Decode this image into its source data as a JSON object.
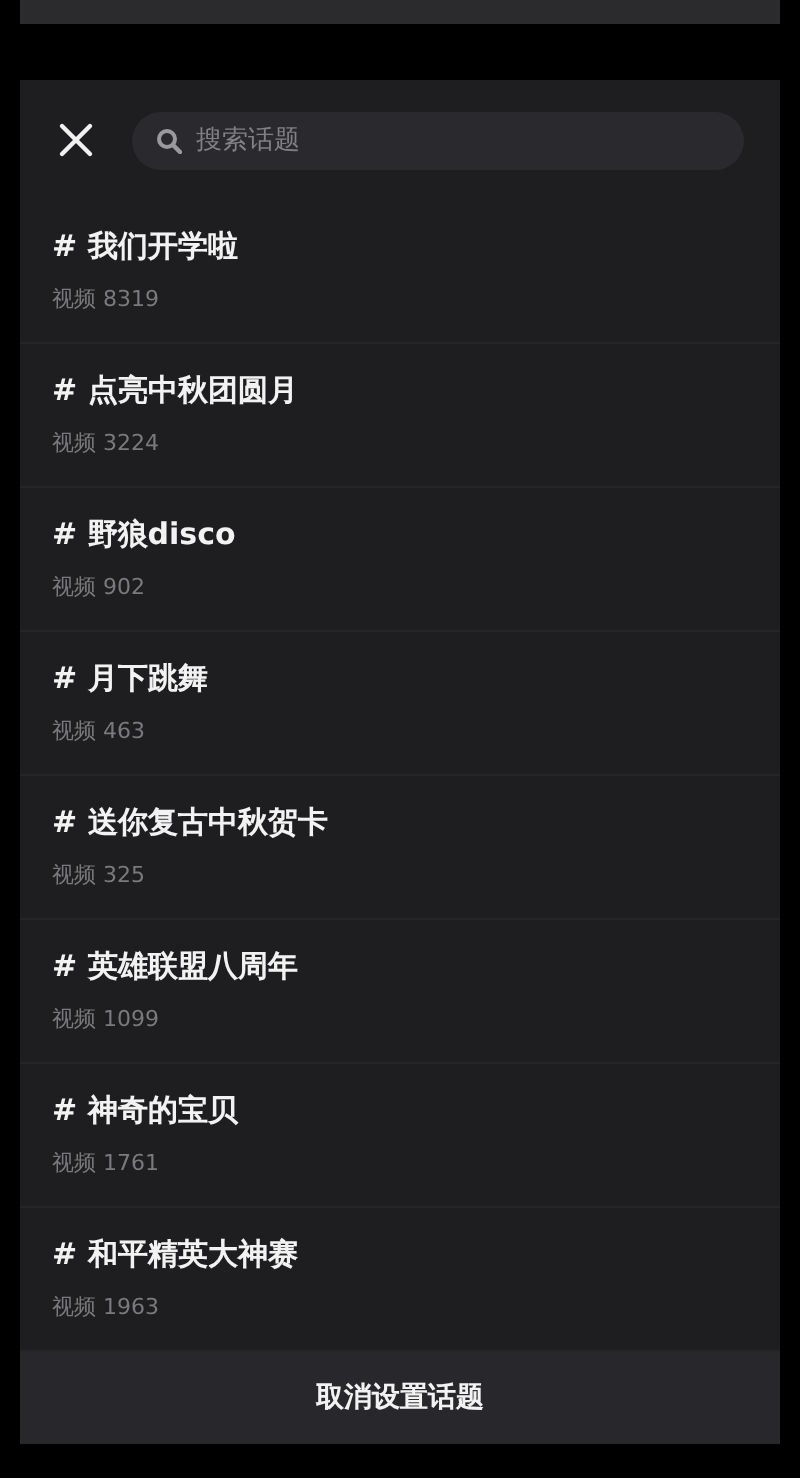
{
  "search": {
    "placeholder": "搜索话题"
  },
  "topics": [
    {
      "title": "# 我们开学啦",
      "meta": "视频 8319"
    },
    {
      "title": "# 点亮中秋团圆月",
      "meta": "视频 3224"
    },
    {
      "title": "# 野狼disco",
      "meta": "视频 902"
    },
    {
      "title": "# 月下跳舞",
      "meta": "视频 463"
    },
    {
      "title": "# 送你复古中秋贺卡",
      "meta": "视频 325"
    },
    {
      "title": "# 英雄联盟八周年",
      "meta": "视频 1099"
    },
    {
      "title": "# 神奇的宝贝",
      "meta": "视频 1761"
    },
    {
      "title": "# 和平精英大神赛",
      "meta": "视频 1963"
    }
  ],
  "bottom_button": "取消设置话题"
}
